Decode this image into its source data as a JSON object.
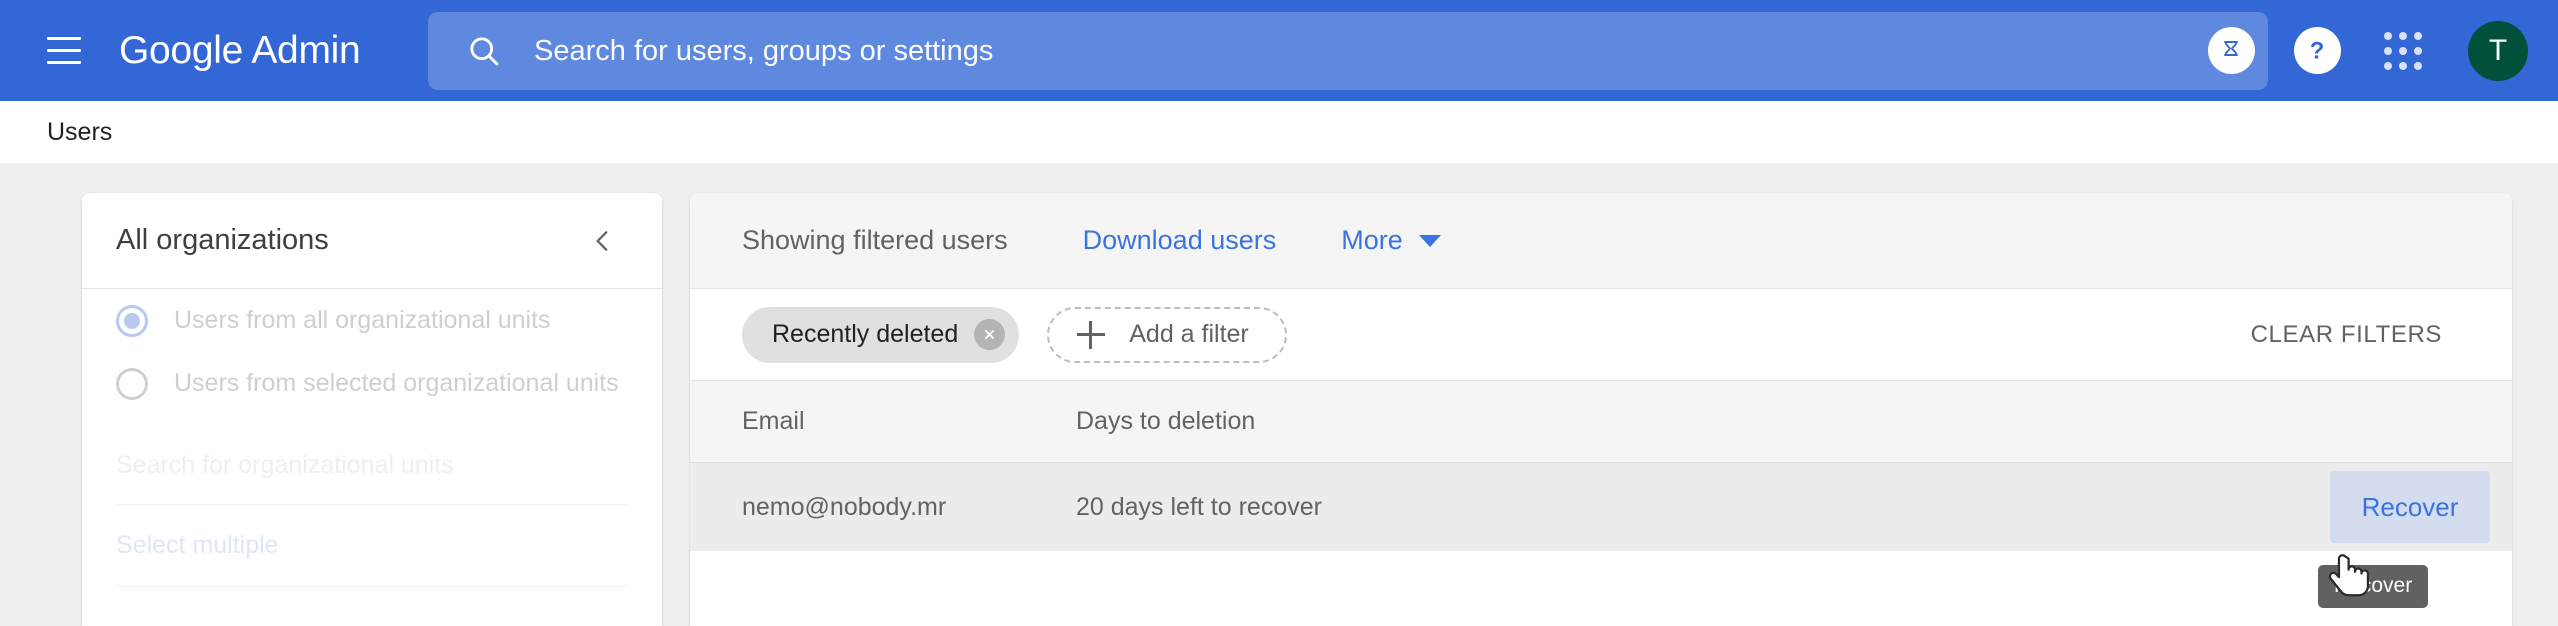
{
  "appbar": {
    "menu_icon": "hamburger-menu-icon",
    "brand": "Google Admin",
    "search": {
      "icon": "search-icon",
      "placeholder": "Search for users, groups or settings",
      "value": ""
    },
    "trial_icon": "hourglass-icon",
    "help_icon": "help-question-icon",
    "apps_icon": "apps-grid-icon",
    "avatar_initial": "T",
    "colors": {
      "bar": "#3367d6",
      "avatar": "#00503c"
    }
  },
  "breadcrumb": {
    "label": "Users"
  },
  "org_panel": {
    "title": "All organizations",
    "collapse_icon": "chevron-left-icon",
    "radios": [
      {
        "label": "Users from all organizational units",
        "selected": true
      },
      {
        "label": "Users from selected organizational units",
        "selected": false
      }
    ],
    "search_placeholder": "Search for organizational units",
    "select_multiple_label": "Select multiple"
  },
  "main_panel": {
    "toolbar": {
      "status": "Showing filtered users",
      "download_label": "Download users",
      "more_label": "More",
      "more_caret_icon": "caret-down-icon"
    },
    "filters": {
      "chips": [
        {
          "label": "Recently deleted",
          "remove_icon": "close-circle-icon"
        }
      ],
      "add_filter_label": "Add a filter",
      "add_filter_icon": "plus-icon",
      "clear_filters_label": "CLEAR FILTERS"
    },
    "table": {
      "columns": [
        "Email",
        "Days to deletion"
      ],
      "rows": [
        {
          "email": "nemo@nobody.mr",
          "days_to_deletion": "20 days left to recover",
          "action_label": "Recover"
        }
      ]
    }
  },
  "tooltip": {
    "text": "Recover"
  }
}
